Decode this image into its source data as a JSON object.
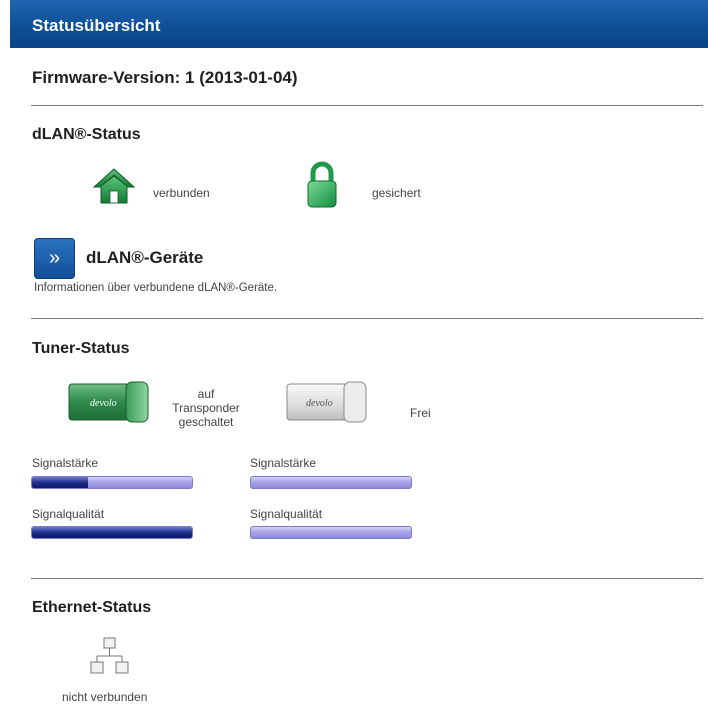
{
  "header": {
    "title": "Statusübersicht"
  },
  "firmware": {
    "label": "Firmware-Version: 1 (2013-01-04)"
  },
  "dlan_status": {
    "title": "dLAN®-Status",
    "connection": {
      "icon": "home-icon",
      "label": "verbunden"
    },
    "security": {
      "icon": "lock-icon",
      "label": "gesichert"
    }
  },
  "dlan_devices": {
    "button_icon": "double-chevron-right-icon",
    "title": "dLAN®-Geräte",
    "description": "Informationen über verbundene dLAN®-Geräte."
  },
  "tuner_status": {
    "title": "Tuner-Status",
    "tuners": [
      {
        "logo_text": "devolo",
        "state_lines": [
          "auf",
          "Transponder",
          "geschaltet"
        ],
        "signal_strength_label": "Signalstärke",
        "signal_strength": 0.35,
        "signal_quality_label": "Signalqualität",
        "signal_quality": 1.0
      },
      {
        "logo_text": "devolo",
        "state_lines": [
          "Frei"
        ],
        "signal_strength_label": "Signalstärke",
        "signal_strength": 0,
        "signal_quality_label": "Signalqualität",
        "signal_quality": 0
      }
    ]
  },
  "ethernet_status": {
    "title": "Ethernet-Status",
    "icon": "network-icon",
    "label": "nicht verbunden"
  }
}
